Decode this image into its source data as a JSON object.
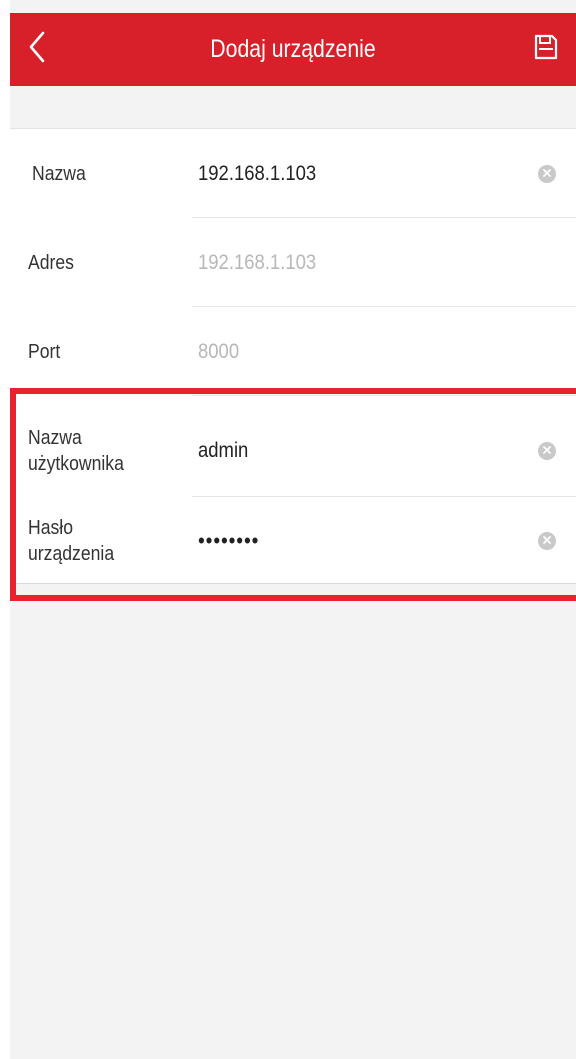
{
  "header": {
    "title": "Dodaj urządzenie",
    "back_icon": "chevron-left-icon",
    "save_icon": "floppy-disk-icon",
    "background_color": "#d8202a"
  },
  "form": {
    "fields": [
      {
        "label": "Nazwa",
        "value": "192.168.1.103",
        "placeholder": "",
        "clear_icon": "clear-icon"
      },
      {
        "label": "Adres",
        "value": "",
        "placeholder": "192.168.1.103"
      },
      {
        "label": "Port",
        "value": "",
        "placeholder": "8000"
      },
      {
        "label": "Nazwa użytkownika",
        "value": "admin",
        "placeholder": "",
        "clear_icon": "clear-icon"
      },
      {
        "label": "Hasło urządzenia",
        "value": "••••••••",
        "placeholder": "",
        "clear_icon": "clear-icon"
      }
    ]
  },
  "highlight": {
    "color": "#e8232e"
  }
}
